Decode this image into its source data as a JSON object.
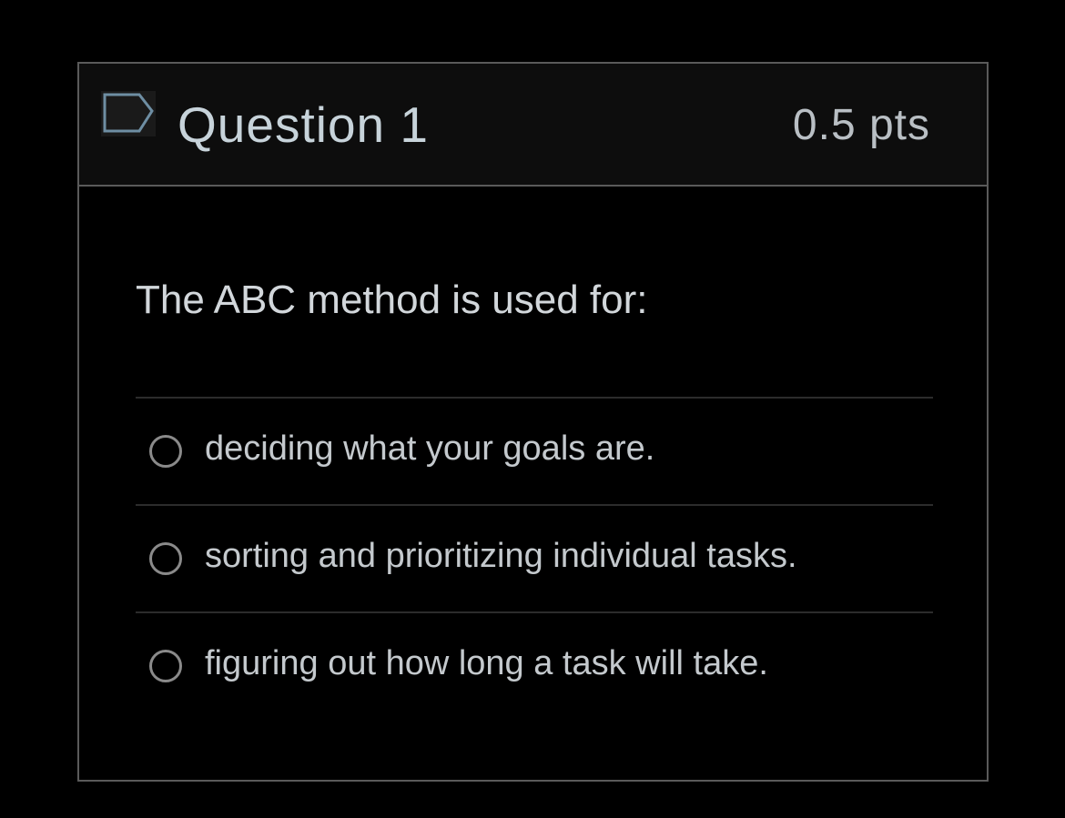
{
  "question": {
    "title": "Question 1",
    "points": "0.5 pts",
    "flag_icon": "flag-outline-icon",
    "text": "The ABC method is used for:"
  },
  "answers": [
    {
      "label": "deciding what your goals are.",
      "selected": false
    },
    {
      "label": "sorting and prioritizing individual tasks.",
      "selected": false
    },
    {
      "label": "figuring out how long a task will take.",
      "selected": false
    }
  ],
  "colors": {
    "background": "#000000",
    "header_background": "#0d0d0d",
    "border": "#5a5a5a",
    "title_text": "#c7d3da",
    "flag_stroke": "#6e8ea3"
  }
}
